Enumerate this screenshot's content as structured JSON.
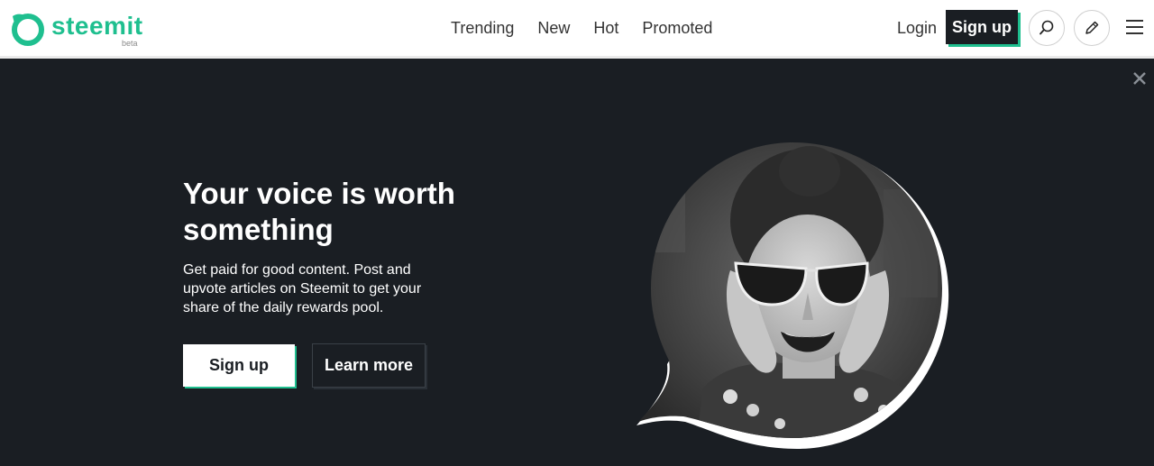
{
  "header": {
    "brand_name": "steemit",
    "brand_tag": "beta",
    "nav": [
      {
        "label": "Trending",
        "active": true
      },
      {
        "label": "New",
        "active": false
      },
      {
        "label": "Hot",
        "active": false
      },
      {
        "label": "Promoted",
        "active": false
      }
    ],
    "login_label": "Login",
    "signup_label": "Sign up",
    "icons": [
      "search-icon",
      "pencil-icon",
      "hamburger-menu-icon"
    ]
  },
  "hero": {
    "title": "Your voice is worth something",
    "description": "Get paid for good content. Post and upvote articles on Steemit to get your share of the daily rewards pool.",
    "signup_label": "Sign up",
    "learn_more_label": "Learn more",
    "close_icon": "close-icon"
  },
  "colors": {
    "brand": "#1fbf8f",
    "dark_bg": "#1a1e23",
    "header_bg": "#ffffff"
  }
}
